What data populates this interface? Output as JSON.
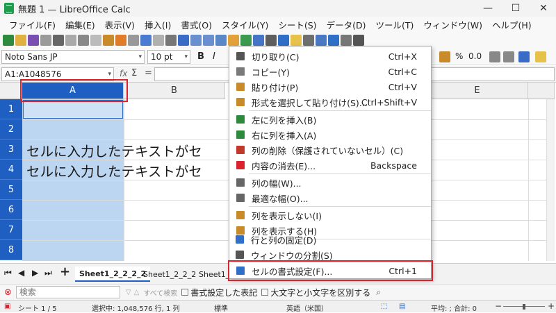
{
  "window": {
    "title": "無題 1 — LibreOffice Calc",
    "minimize": "—",
    "maximize": "☐",
    "close": "✕"
  },
  "menu": [
    "ファイル(F)",
    "編集(E)",
    "表示(V)",
    "挿入(I)",
    "書式(O)",
    "スタイル(Y)",
    "シート(S)",
    "データ(D)",
    "ツール(T)",
    "ウィンドウ(W)",
    "ヘルプ(H)"
  ],
  "format_bar": {
    "font_name": "Noto Sans JP",
    "font_size": "10 pt",
    "bold": "B",
    "italic": "I",
    "percent": "%",
    "decimal": "0.0"
  },
  "formula_bar": {
    "name_box": "A1:A1048576",
    "fx": "fx",
    "sum": "Σ",
    "equals": "="
  },
  "columns": [
    "A",
    "B",
    "E"
  ],
  "rows": [
    "1",
    "2",
    "3",
    "4",
    "5",
    "6",
    "7",
    "8"
  ],
  "cells": {
    "row3": "セルに入力したテキストがセ",
    "row4": "セルに入力したテキストがセ"
  },
  "context_menu": [
    {
      "label": "切り取り(C)",
      "shortcut": "Ctrl+X",
      "icon": "scissors-icon",
      "color": "#555555"
    },
    {
      "label": "コピー(Y)",
      "shortcut": "Ctrl+C",
      "icon": "copy-icon",
      "color": "#7a7a7a"
    },
    {
      "label": "貼り付け(P)",
      "shortcut": "Ctrl+V",
      "icon": "paste-icon",
      "color": "#c98a2a"
    },
    {
      "label": "形式を選択して貼り付け(S)...",
      "shortcut": "Ctrl+Shift+V",
      "icon": "paste-special-icon",
      "color": "#c98a2a"
    },
    {
      "label": "左に列を挿入(B)",
      "shortcut": "",
      "icon": "insert-column-left-icon",
      "color": "#2e8b3e"
    },
    {
      "label": "右に列を挿入(A)",
      "shortcut": "",
      "icon": "insert-column-right-icon",
      "color": "#2e8b3e"
    },
    {
      "label": "列の削除（保護されていないセル）(C)",
      "shortcut": "",
      "icon": "delete-column-icon",
      "color": "#c0392b"
    },
    {
      "label": "内容の消去(E)...",
      "shortcut": "Backspace",
      "icon": "clear-contents-icon",
      "color": "#d9232e"
    },
    {
      "label": "列の幅(W)...",
      "shortcut": "",
      "icon": "column-width-icon",
      "color": "#666666"
    },
    {
      "label": "最適な幅(O)...",
      "shortcut": "",
      "icon": "optimal-width-icon",
      "color": "#666666"
    },
    {
      "label": "列を表示しない(I)",
      "shortcut": "",
      "icon": "hide-column-icon",
      "color": "#c98a2a"
    },
    {
      "label": "列を表示する(H)",
      "shortcut": "",
      "icon": "show-column-icon",
      "color": "#c98a2a"
    },
    {
      "label": "行と列の固定(D)",
      "shortcut": "",
      "icon": "freeze-icon",
      "color": "#2f6fc7"
    },
    {
      "label": "ウィンドウの分割(S)",
      "shortcut": "",
      "icon": "split-window-icon",
      "color": "#555555"
    },
    {
      "label": "セルの書式設定(F)...",
      "shortcut": "Ctrl+1",
      "icon": "format-cells-icon",
      "color": "#2f6fc7"
    }
  ],
  "sheet_tabs": [
    "Sheet1_2_2_2_2",
    "Sheet1_2_2_2",
    "Sheet1_2_2"
  ],
  "find_bar": {
    "placeholder": "検索",
    "find_all": "すべて検索",
    "formatted_display": "書式設定した表記",
    "match_case": "大文字と小文字を区別する"
  },
  "status_bar": {
    "sheet": "シート 1 / 5",
    "selection": "選択中: 1,048,576 行, 1 列",
    "style": "標準",
    "language": "英語（米国）",
    "sum": "平均: ; 合計: 0",
    "zoom_out": "−",
    "zoom_in": "+"
  },
  "accent": "#1e5fc1",
  "highlight_box": "#d9232e"
}
